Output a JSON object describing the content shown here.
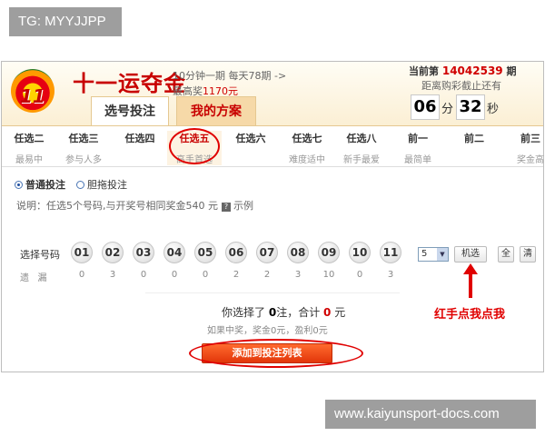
{
  "watermark_top": "TG: MYYJJPP",
  "watermark_bottom": "www.kaiyunsport-docs.com",
  "header": {
    "logo_number": "11",
    "title": "十一运夺金",
    "subtitle_line1": "10分钟一期 每天78期 ->",
    "subtitle_prize_prefix": "最高奖",
    "subtitle_prize_value": "1170元",
    "tabs": [
      "选号投注",
      "我的方案"
    ]
  },
  "issue": {
    "prefix": "当前第",
    "number": "14042539",
    "suffix": "期",
    "closing_label": "距离购彩截止还有",
    "minutes": "06",
    "minutes_unit": "分",
    "seconds": "32",
    "seconds_unit": "秒"
  },
  "subtabs": [
    {
      "name": "任选二",
      "desc": "最易中"
    },
    {
      "name": "任选三",
      "desc": "参与人多"
    },
    {
      "name": "任选四",
      "desc": ""
    },
    {
      "name": "任选五",
      "desc": "高手首选"
    },
    {
      "name": "任选六",
      "desc": ""
    },
    {
      "name": "任选七",
      "desc": "难度适中"
    },
    {
      "name": "任选八",
      "desc": "新手最爱"
    },
    {
      "name": "前一",
      "desc": "最简单"
    },
    {
      "name": "前二",
      "desc": ""
    },
    {
      "name": "前三",
      "desc": "奖金高"
    }
  ],
  "modes": {
    "normal": "普通投注",
    "banker": "胆拖投注"
  },
  "description": "说明：任选5个号码,与开奖号相同奖金540 元",
  "help_icon_text": "?",
  "example_label": "示例",
  "selection": {
    "pick_label": "选择号码",
    "miss_label": "遗   漏",
    "balls": [
      "01",
      "02",
      "03",
      "04",
      "05",
      "06",
      "07",
      "08",
      "09",
      "10",
      "11"
    ],
    "misses": [
      "0",
      "3",
      "0",
      "0",
      "0",
      "2",
      "2",
      "3",
      "10",
      "0",
      "3"
    ],
    "quantity_value": "5",
    "random_button": "机选",
    "all_button": "全",
    "clear_button": "清"
  },
  "annotation": "红手点我点我",
  "summary": {
    "selected_prefix": "你选择了",
    "bets_value": "0",
    "bets_unit": "注，合计",
    "amount_value": "0",
    "amount_unit": "元",
    "prize_line": "如果中奖，奖金0元，盈利0元"
  },
  "add_button": "添加到投注列表",
  "colors": {
    "accent_red": "#c80000",
    "highlight": "#e00000",
    "tab_bg": "#f6d9a8",
    "button_orange": "#ff6a2e"
  }
}
